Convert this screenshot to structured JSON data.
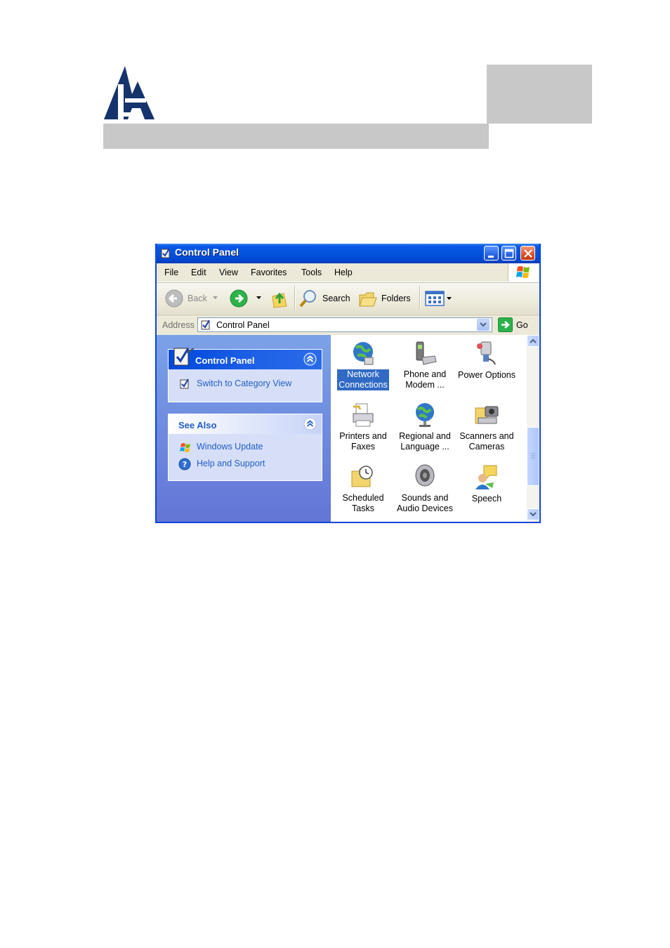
{
  "window": {
    "title": "Control Panel",
    "buttons": {
      "minimize": "minimize",
      "maximize": "maximize",
      "close": "close"
    }
  },
  "menu": [
    "File",
    "Edit",
    "View",
    "Favorites",
    "Tools",
    "Help"
  ],
  "toolbar": {
    "back_label": "Back",
    "search_label": "Search",
    "folders_label": "Folders"
  },
  "address": {
    "label": "Address",
    "value": "Control Panel",
    "go_label": "Go"
  },
  "taskpane": {
    "panel_main": {
      "title": "Control Panel",
      "links": [
        "Switch to Category View"
      ]
    },
    "panel_see_also": {
      "title": "See Also",
      "links": [
        "Windows Update",
        "Help and Support"
      ]
    }
  },
  "items": [
    {
      "label": "Network\nConnections",
      "icon": "network-connections-icon",
      "selected": true
    },
    {
      "label": "Phone and\nModem ...",
      "icon": "phone-modem-icon"
    },
    {
      "label": "Power Options",
      "icon": "power-options-icon"
    },
    {
      "label": "Printers and\nFaxes",
      "icon": "printers-faxes-icon"
    },
    {
      "label": "Regional and\nLanguage ...",
      "icon": "regional-language-icon"
    },
    {
      "label": "Scanners and\nCameras",
      "icon": "scanners-cameras-icon"
    },
    {
      "label": "Scheduled\nTasks",
      "icon": "scheduled-tasks-icon"
    },
    {
      "label": "Sounds and\nAudio Devices",
      "icon": "sounds-audio-icon"
    },
    {
      "label": "Speech",
      "icon": "speech-icon"
    }
  ],
  "colors": {
    "title_bar": "#0453dc",
    "task_pane": "#6f8fe0",
    "link": "#215dc6",
    "selection": "#316ac5",
    "header_gray": "#c8c8c8"
  }
}
